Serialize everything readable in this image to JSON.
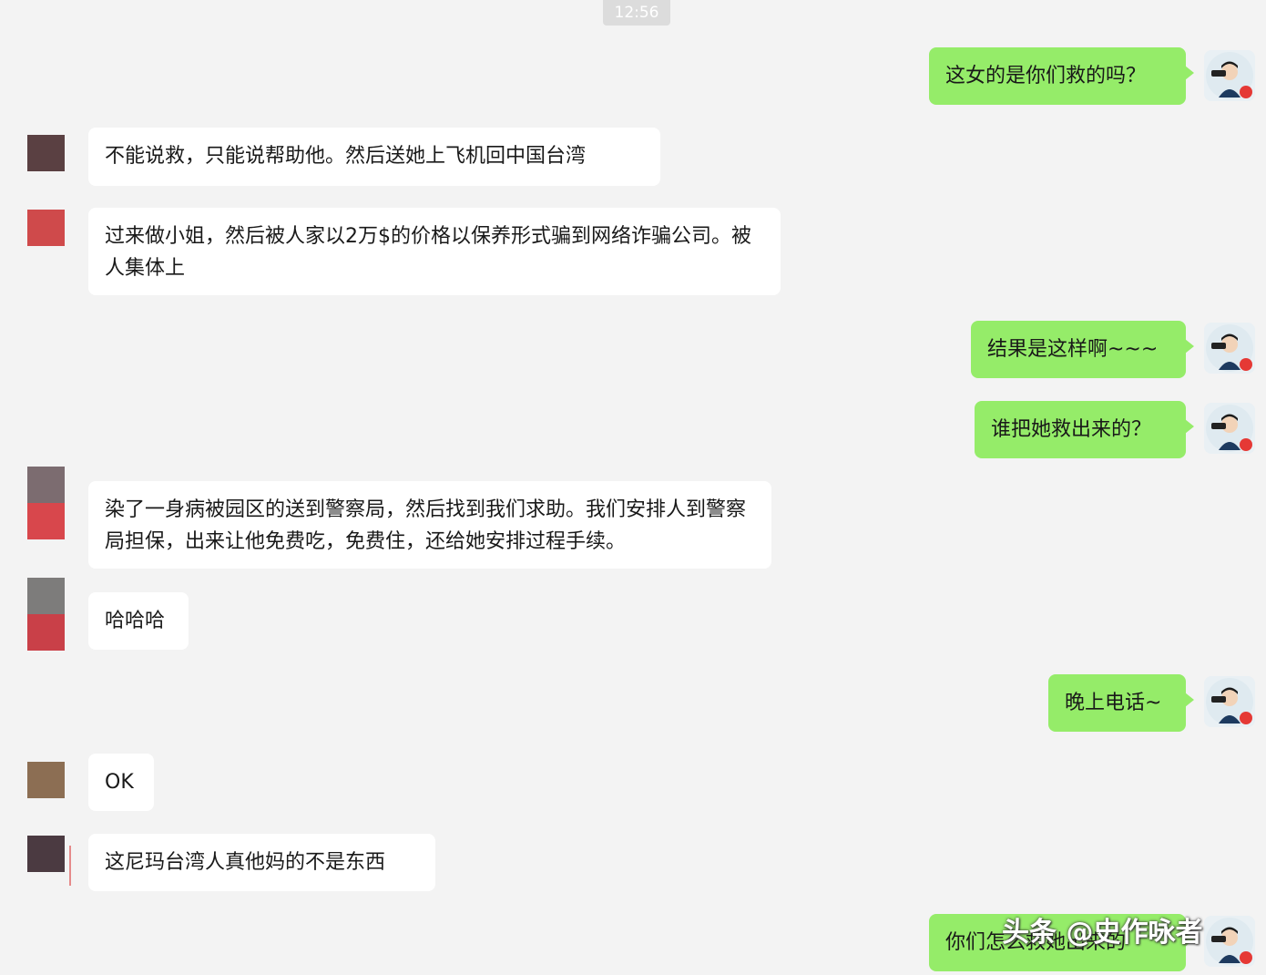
{
  "timestamp": "12:56",
  "messages": [
    {
      "side": "out",
      "text": "这女的是你们救的吗？"
    },
    {
      "side": "in",
      "text": "不能说救，只能说帮助他。然后送她上飞机回中国台湾"
    },
    {
      "side": "in",
      "text": "过来做小姐，然后被人家以2万$的价格以保养形式骗到网络诈骗公司。被人集体上"
    },
    {
      "side": "out",
      "text": "结果是这样啊~~~"
    },
    {
      "side": "out",
      "text": "谁把她救出来的？"
    },
    {
      "side": "in",
      "text": "染了一身病被园区的送到警察局，然后找到我们求助。我们安排人到警察局担保，出来让他免费吃，免费住，还给她安排过程手续。"
    },
    {
      "side": "in",
      "text": "哈哈哈"
    },
    {
      "side": "out",
      "text": "晚上电话~"
    },
    {
      "side": "in",
      "text": "OK"
    },
    {
      "side": "in",
      "text": "这尼玛台湾人真他妈的不是东西"
    },
    {
      "side": "out",
      "text": "你们怎么救她出来的"
    }
  ],
  "watermark": "头条 @史作咏者",
  "colors": {
    "background": "#f3f3f3",
    "out_bubble": "#95ec69",
    "in_bubble": "#ffffff"
  },
  "icons": {
    "my_avatar": "photographer-avatar-icon"
  }
}
